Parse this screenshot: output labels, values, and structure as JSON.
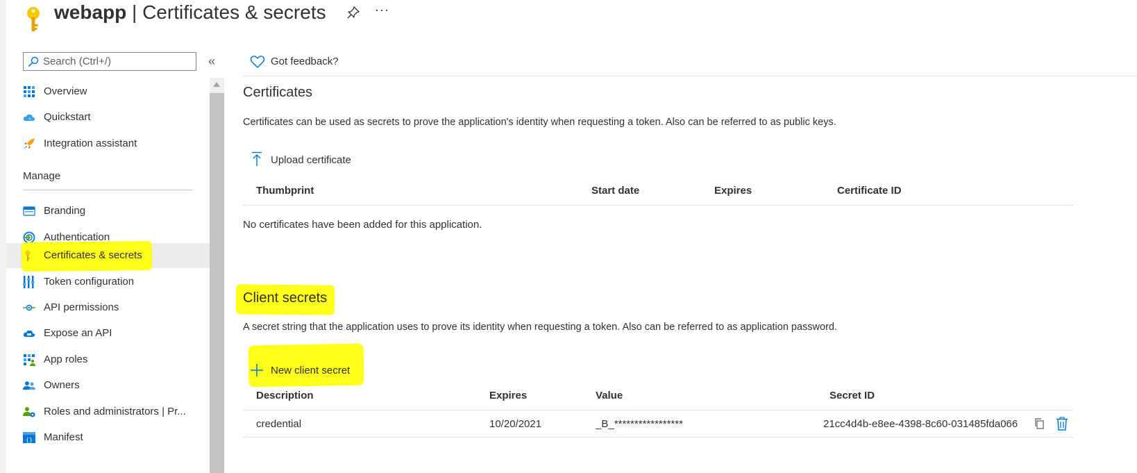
{
  "header": {
    "app_name": "webapp",
    "separator": " | ",
    "page_title": "Certificates & secrets",
    "more_label": "···"
  },
  "sidebar": {
    "search_placeholder": "Search (Ctrl+/)",
    "collapse_label": "«",
    "items_top": [
      {
        "label": "Overview",
        "icon": "overview-grid-icon"
      },
      {
        "label": "Quickstart",
        "icon": "cloud-icon"
      },
      {
        "label": "Integration assistant",
        "icon": "rocket-icon"
      }
    ],
    "manage_heading": "Manage",
    "items_manage": [
      {
        "label": "Branding",
        "icon": "branding-icon"
      },
      {
        "label": "Authentication",
        "icon": "authentication-icon"
      },
      {
        "label": "Certificates & secrets",
        "icon": "key-icon",
        "active": true
      },
      {
        "label": "Token configuration",
        "icon": "token-bars-icon"
      },
      {
        "label": "API permissions",
        "icon": "api-permissions-icon"
      },
      {
        "label": "Expose an API",
        "icon": "cloud-api-icon"
      },
      {
        "label": "App roles",
        "icon": "app-roles-icon"
      },
      {
        "label": "Owners",
        "icon": "owners-icon"
      },
      {
        "label": "Roles and administrators | Pr...",
        "icon": "roles-admin-icon"
      },
      {
        "label": "Manifest",
        "icon": "manifest-icon"
      }
    ]
  },
  "toolbar": {
    "feedback_label": "Got feedback?"
  },
  "certificates": {
    "heading": "Certificates",
    "description": "Certificates can be used as secrets to prove the application's identity when requesting a token. Also can be referred to as public keys.",
    "upload_label": "Upload certificate",
    "columns": [
      "Thumbprint",
      "Start date",
      "Expires",
      "Certificate ID"
    ],
    "empty_message": "No certificates have been added for this application."
  },
  "client_secrets": {
    "heading": "Client secrets",
    "description": "A secret string that the application uses to prove its identity when requesting a token. Also can be referred to as application password.",
    "new_label": "New client secret",
    "columns": [
      "Description",
      "Expires",
      "Value",
      "Secret ID"
    ],
    "rows": [
      {
        "description": "credential",
        "expires": "10/20/2021",
        "value": "_B_*****************",
        "secret_id": "21cc4d4b-e8ee-4398-8c60-031485fda066"
      }
    ]
  },
  "colors": {
    "accent": "#0078d4",
    "highlight": "#ffff1a",
    "key_yellow": "#f2c811",
    "nav_active_bg": "#edebe9"
  }
}
